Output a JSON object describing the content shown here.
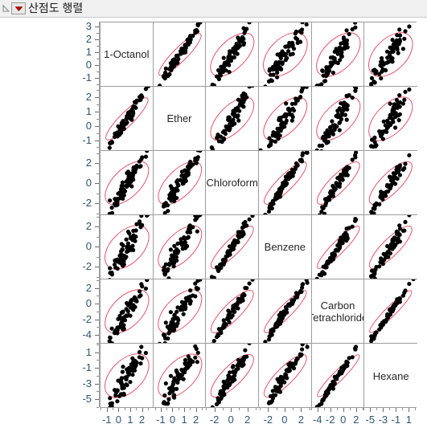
{
  "window": {
    "title": "산점도 행렬",
    "disclosure_icon": "triangle-collapse-icon",
    "menu_icon": "red-dropdown-triangle-icon"
  },
  "chart_data": {
    "type": "scatter",
    "title": "산점도 행렬",
    "plot_kind": "scatterplot-matrix",
    "grid": false,
    "legend": "none",
    "ellipse_color": "#e8546a",
    "point_color": "#000000",
    "variables": [
      {
        "name": "1-Octanol",
        "yticks": [
          3,
          2,
          1,
          0,
          -1
        ],
        "xticks": [
          -1,
          0,
          1,
          2
        ],
        "ylim": [
          -1.6,
          3.4
        ],
        "xlim": [
          -1.6,
          2.9
        ]
      },
      {
        "name": "Ether",
        "yticks": [
          2,
          1,
          0,
          -1
        ],
        "xticks": [
          -1,
          0,
          1,
          2
        ],
        "ylim": [
          -1.7,
          2.8
        ],
        "xlim": [
          -1.7,
          2.8
        ]
      },
      {
        "name": "Chloroform",
        "yticks": [
          2,
          0,
          -2
        ],
        "xticks": [
          -2,
          0,
          2
        ],
        "ylim": [
          -3.1,
          3.3
        ],
        "xlim": [
          -3.1,
          3.3
        ]
      },
      {
        "name": "Benzene",
        "yticks": [
          2,
          0,
          -2
        ],
        "xticks": [
          -2,
          0,
          2
        ],
        "ylim": [
          -3.2,
          3.2
        ],
        "xlim": [
          -3.2,
          3.2
        ]
      },
      {
        "name": "Carbon\nTetrachloride",
        "name_line1": "Carbon",
        "name_line2": "Tetrachloride",
        "yticks": [
          2,
          0,
          -2,
          -4
        ],
        "xticks": [
          -4,
          -2,
          0,
          2
        ],
        "ylim": [
          -5.0,
          3.2
        ],
        "xlim": [
          -5.0,
          3.2
        ]
      },
      {
        "name": "Hexane",
        "yticks": [
          1,
          -1,
          -3,
          -5
        ],
        "xticks": [
          -5,
          -3,
          -1,
          1
        ],
        "ylim": [
          -6.0,
          2.2
        ],
        "xlim": [
          -6.0,
          2.2
        ]
      }
    ],
    "correlations": [
      [
        1.0,
        0.93,
        0.71,
        0.62,
        0.66,
        0.62
      ],
      [
        0.93,
        1.0,
        0.74,
        0.72,
        0.7,
        0.68
      ],
      [
        0.71,
        0.74,
        1.0,
        0.91,
        0.89,
        0.85
      ],
      [
        0.62,
        0.72,
        0.91,
        1.0,
        0.94,
        0.89
      ],
      [
        0.66,
        0.7,
        0.89,
        0.94,
        1.0,
        0.96
      ],
      [
        0.62,
        0.68,
        0.85,
        0.89,
        0.96,
        1.0
      ]
    ],
    "n_points": 70
  }
}
